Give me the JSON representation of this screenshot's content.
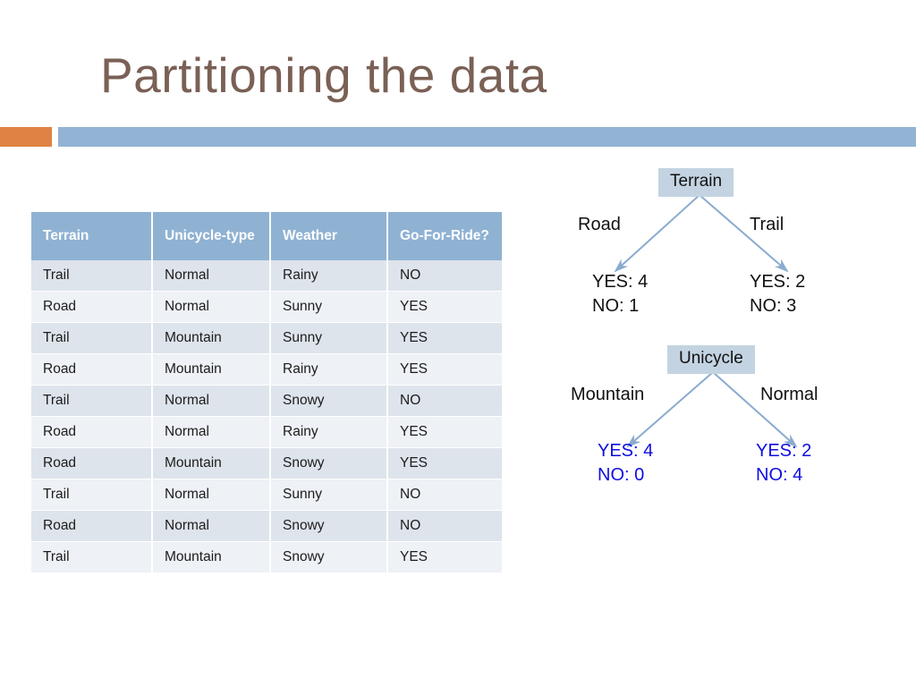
{
  "slide": {
    "title": "Partitioning the data"
  },
  "colors": {
    "title_text": "#7a6055",
    "accent_bar": "#df8244",
    "divider_bar": "#92b3d3",
    "table_header_bg": "#8fb2d3",
    "table_row_odd_bg": "#dee4ec",
    "table_row_even_bg": "#eef1f6",
    "node_bg": "#c3d3e1",
    "arrow": "#8aabce",
    "leaf_black": "#111111",
    "leaf_blue": "#0d0de0"
  },
  "table": {
    "columns": [
      "Terrain",
      "Unicycle-type",
      "Weather",
      "Go-For-Ride?"
    ],
    "rows": [
      [
        "Trail",
        "Normal",
        "Rainy",
        "NO"
      ],
      [
        "Road",
        "Normal",
        "Sunny",
        "YES"
      ],
      [
        "Trail",
        "Mountain",
        "Sunny",
        "YES"
      ],
      [
        "Road",
        "Mountain",
        "Rainy",
        "YES"
      ],
      [
        "Trail",
        "Normal",
        "Snowy",
        "NO"
      ],
      [
        "Road",
        "Normal",
        "Rainy",
        "YES"
      ],
      [
        "Road",
        "Mountain",
        "Snowy",
        "YES"
      ],
      [
        "Trail",
        "Normal",
        "Sunny",
        "NO"
      ],
      [
        "Road",
        "Normal",
        "Snowy",
        "NO"
      ],
      [
        "Trail",
        "Mountain",
        "Snowy",
        "YES"
      ]
    ]
  },
  "trees": [
    {
      "id": "terrain",
      "node": "Terrain",
      "left_branch_label": "Road",
      "right_branch_label": "Trail",
      "left_leaf": "YES: 4\nNO: 1",
      "right_leaf": "YES: 2\nNO: 3",
      "leaf_color": "black"
    },
    {
      "id": "unicycle",
      "node": "Unicycle",
      "left_branch_label": "Mountain",
      "right_branch_label": "Normal",
      "left_leaf": "YES: 4\nNO: 0",
      "right_leaf": "YES: 2\nNO: 4",
      "leaf_color": "blue"
    }
  ]
}
